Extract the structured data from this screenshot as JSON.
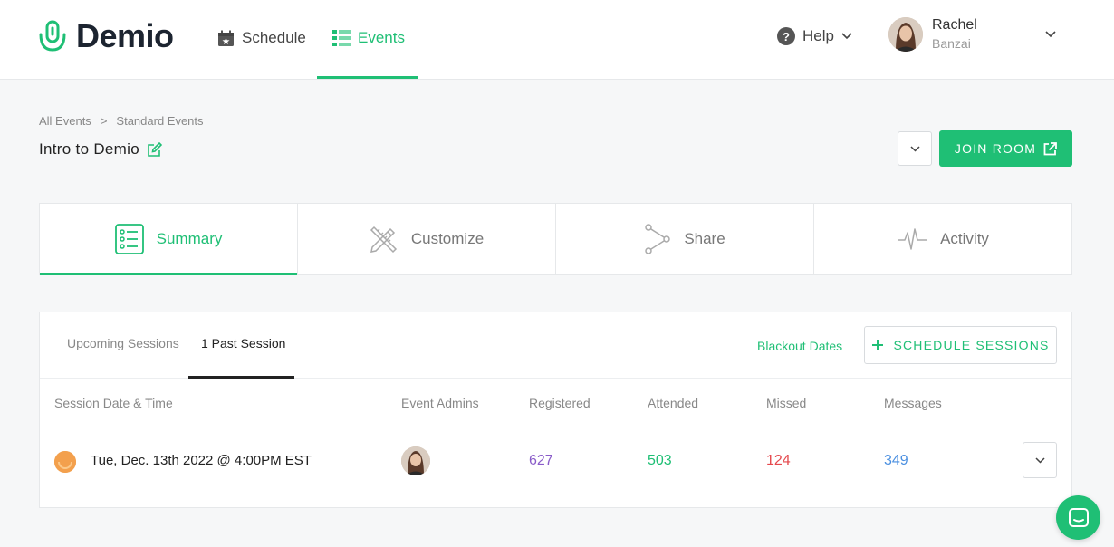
{
  "brand": {
    "name": "Demio",
    "accent": "#1fbf75"
  },
  "nav": {
    "schedule": "Schedule",
    "events": "Events",
    "help": "Help"
  },
  "user": {
    "first": "Rachel",
    "last": "Banzai"
  },
  "breadcrumb": {
    "root": "All Events",
    "sep": ">",
    "current": "Standard Events"
  },
  "event": {
    "title": "Intro to Demio",
    "join_label": "JOIN ROOM"
  },
  "tabs": [
    {
      "label": "Summary",
      "icon": "list-icon"
    },
    {
      "label": "Customize",
      "icon": "pencil-ruler-icon"
    },
    {
      "label": "Share",
      "icon": "share-icon"
    },
    {
      "label": "Activity",
      "icon": "pulse-icon"
    }
  ],
  "sessions": {
    "tabs": {
      "upcoming": "Upcoming Sessions",
      "past": "1 Past Session"
    },
    "blackout": "Blackout Dates",
    "schedule_btn": "SCHEDULE SESSIONS",
    "columns": {
      "date": "Session Date & Time",
      "admins": "Event Admins",
      "registered": "Registered",
      "attended": "Attended",
      "missed": "Missed",
      "messages": "Messages"
    },
    "rows": [
      {
        "date": "Tue, Dec. 13th 2022 @ 4:00PM EST",
        "registered": "627",
        "attended": "503",
        "missed": "124",
        "messages": "349"
      }
    ]
  },
  "colors": {
    "registered": "#8a5cc9",
    "attended": "#1fbf75",
    "missed": "#e5484d",
    "messages": "#4a8fe0"
  }
}
